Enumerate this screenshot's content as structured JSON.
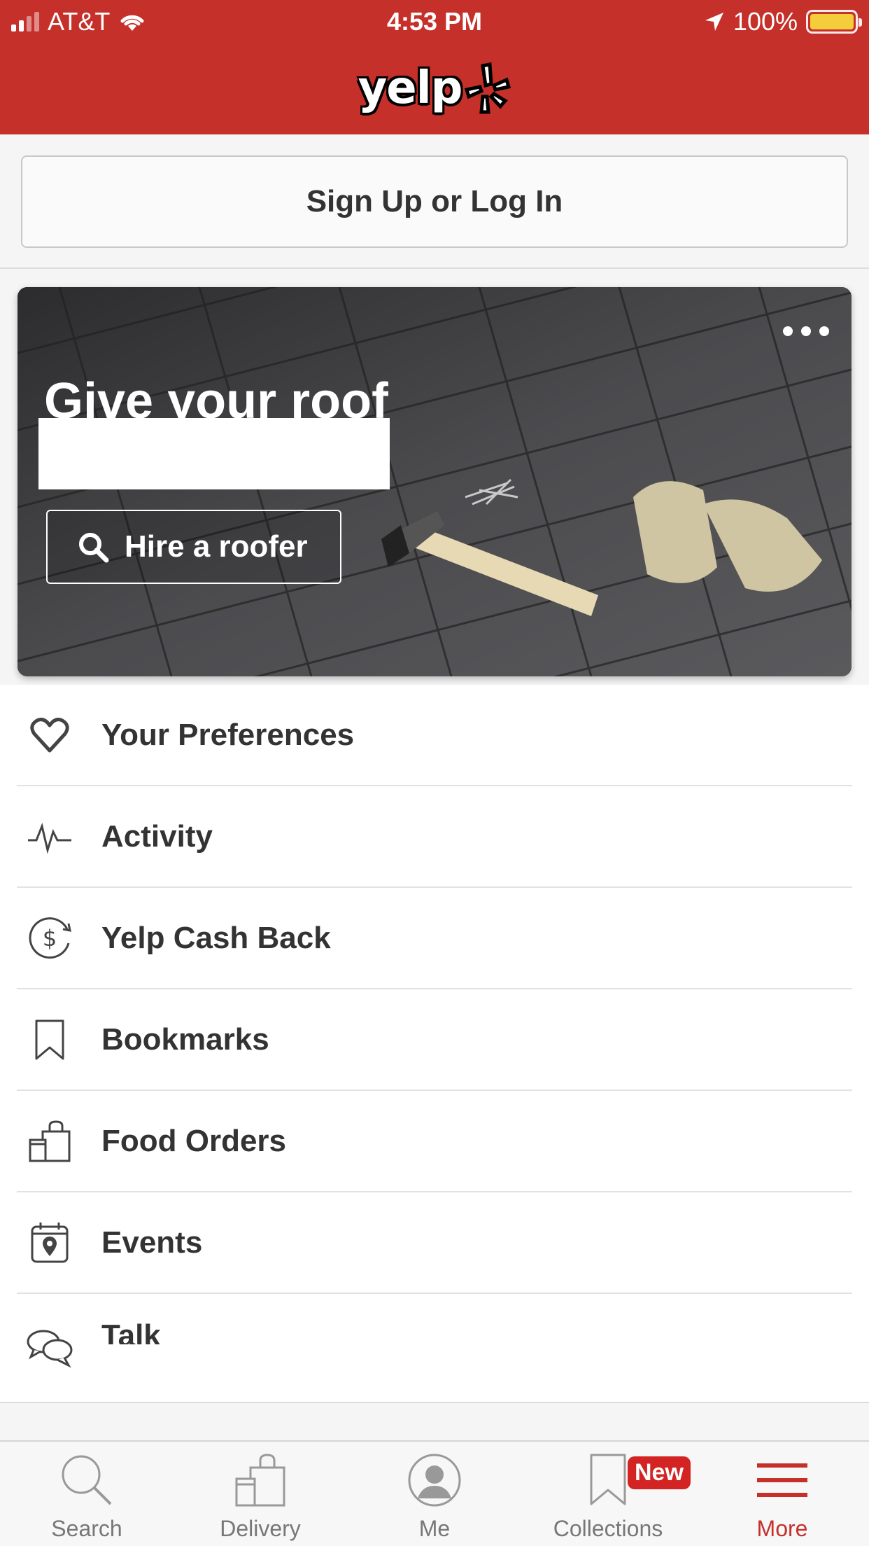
{
  "status_bar": {
    "carrier": "AT&T",
    "time": "4:53 PM",
    "battery": "100%"
  },
  "header": {
    "logo_text": "yelp",
    "brand_color": "#c5302a"
  },
  "signup": {
    "label": "Sign Up or Log In"
  },
  "banner": {
    "headline": "Give your roof",
    "cta_label": "Hire a roofer",
    "more_icon": "ellipsis-icon"
  },
  "menu": {
    "items": [
      {
        "label": "Your Preferences",
        "icon": "heart-icon"
      },
      {
        "label": "Activity",
        "icon": "pulse-icon"
      },
      {
        "label": "Yelp Cash Back",
        "icon": "cash-back-icon"
      },
      {
        "label": "Bookmarks",
        "icon": "bookmark-icon"
      },
      {
        "label": "Food Orders",
        "icon": "shopping-bag-icon"
      },
      {
        "label": "Events",
        "icon": "calendar-icon"
      },
      {
        "label": "Talk",
        "icon": "chat-bubbles-icon"
      }
    ]
  },
  "tabbar": {
    "tabs": [
      {
        "label": "Search",
        "icon": "search-icon"
      },
      {
        "label": "Delivery",
        "icon": "delivery-bag-icon"
      },
      {
        "label": "Me",
        "icon": "profile-icon"
      },
      {
        "label": "Collections",
        "icon": "bookmark-icon",
        "badge": "New"
      },
      {
        "label": "More",
        "icon": "hamburger-icon",
        "active": true
      }
    ]
  }
}
